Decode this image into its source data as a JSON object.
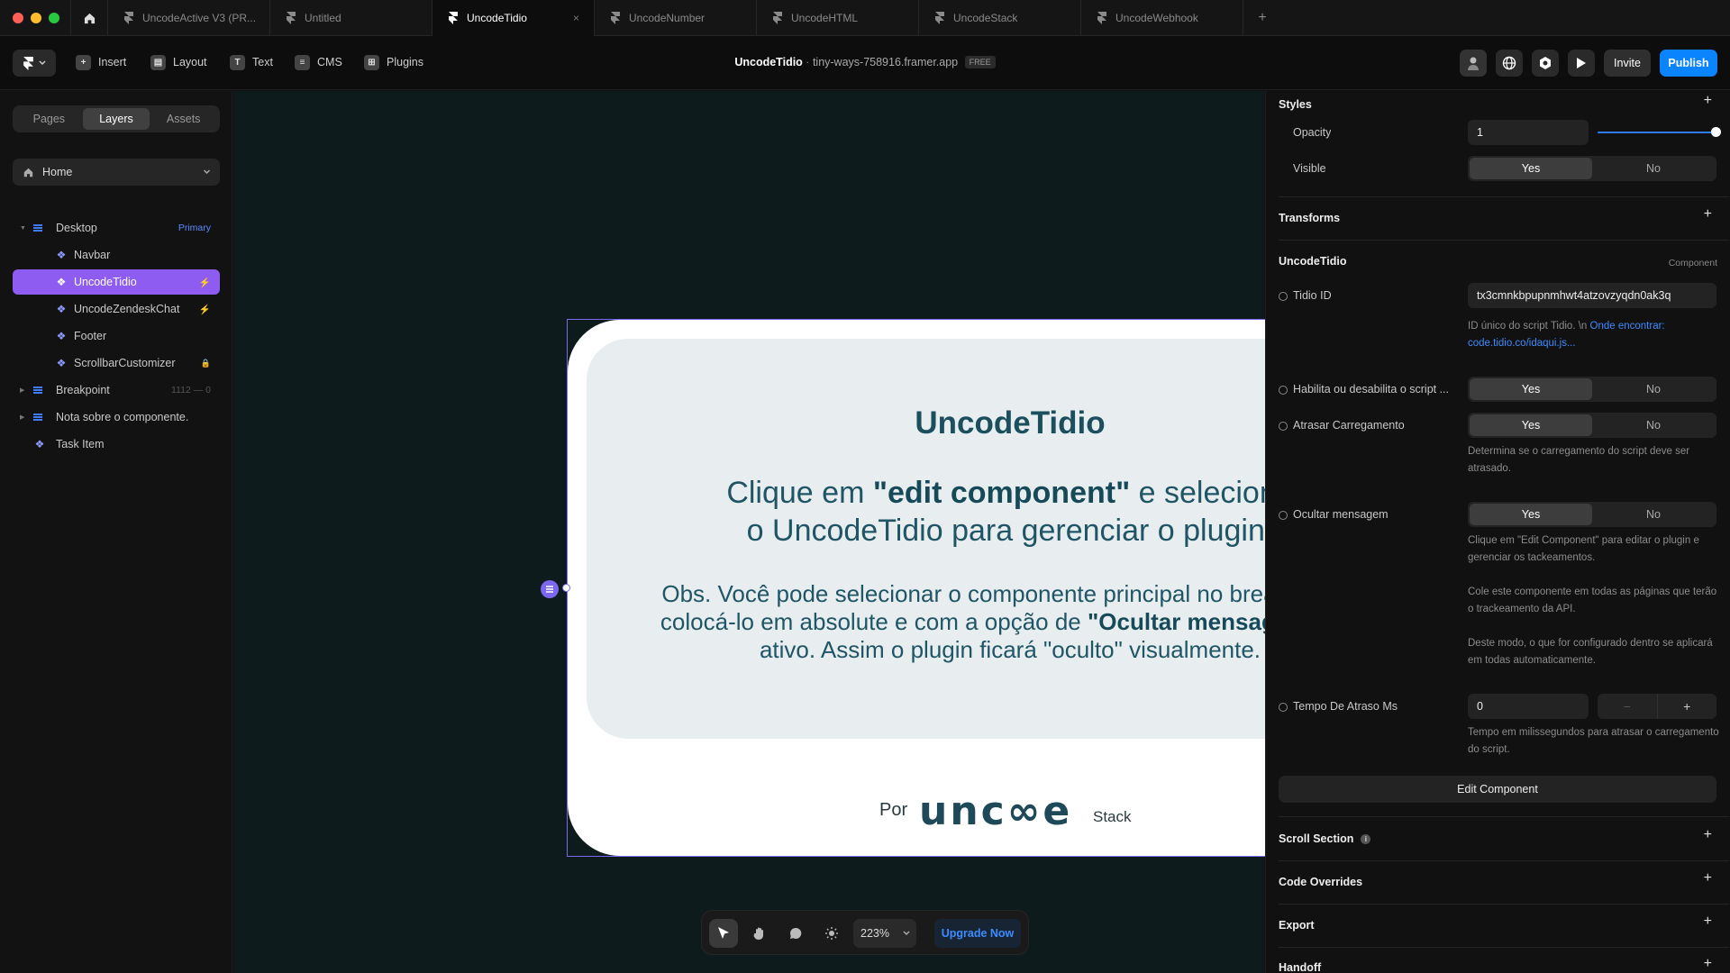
{
  "tabs": [
    {
      "label": "UncodeActive V3 (PR...",
      "active": false
    },
    {
      "label": "Untitled",
      "active": false
    },
    {
      "label": "UncodeTidio",
      "active": true,
      "close": "×"
    },
    {
      "label": "UncodeNumber",
      "active": false
    },
    {
      "label": "UncodeHTML",
      "active": false
    },
    {
      "label": "UncodeStack",
      "active": false
    },
    {
      "label": "UncodeWebhook",
      "active": false
    }
  ],
  "new_tab": "+",
  "toolbar": {
    "items": [
      "Insert",
      "Layout",
      "Text",
      "CMS",
      "Plugins"
    ],
    "project_name": "UncodeTidio",
    "project_domain": "tiny-ways-758916.framer.app",
    "plan_badge": "FREE",
    "invite": "Invite",
    "publish": "Publish"
  },
  "left_panel": {
    "tabs": [
      "Pages",
      "Layers",
      "Assets"
    ],
    "active_tab": "Layers",
    "page_select": "Home",
    "layers": [
      {
        "label": "Desktop",
        "type": "frame",
        "right": "Primary",
        "indent": 0,
        "caret": true
      },
      {
        "label": "Navbar",
        "type": "component",
        "right": "",
        "indent": 1
      },
      {
        "label": "UncodeTidio",
        "type": "component",
        "right": "⚡",
        "indent": 1,
        "selected": true
      },
      {
        "label": "UncodeZendeskChat",
        "type": "component",
        "right": "⚡",
        "indent": 1
      },
      {
        "label": "Footer",
        "type": "component",
        "right": "",
        "indent": 1
      },
      {
        "label": "ScrollbarCustomizer",
        "type": "component",
        "right": "🔒",
        "indent": 1
      },
      {
        "label": "Breakpoint",
        "type": "frame",
        "right": "1112 — 0",
        "indent": 0,
        "caret": true
      },
      {
        "label": "Nota sobre o componente.",
        "type": "frame",
        "right": "",
        "indent": 0,
        "caret": true
      },
      {
        "label": "Task Item",
        "type": "component",
        "right": "",
        "indent": 0
      }
    ]
  },
  "canvas": {
    "title": "UncodeTidio",
    "line1_pre": "Clique em ",
    "line1_bold": "\"edit component\"",
    "line1_post": " e selecione",
    "line2": "o UncodeTidio para gerenciar o plugin.",
    "obs_pre": "Obs. Você pode selecionar o componente principal no breakpoint e colocá-lo em absolute e com a opção de ",
    "obs_bold": "\"Ocultar mensagem\"",
    "obs_post": " em ativo. Assim o plugin ficará \"oculto\" visualmente.",
    "brand_por": "Por",
    "brand_logo": "unc∞e",
    "brand_stack": "Stack",
    "zoom": "223%",
    "upgrade": "Upgrade Now"
  },
  "right_panel": {
    "styles_title": "Styles",
    "opacity_label": "Opacity",
    "opacity_value": "1",
    "visible_label": "Visible",
    "visible_yes": "Yes",
    "visible_no": "No",
    "transforms_title": "Transforms",
    "component_title": "UncodeTidio",
    "component_tag": "Component",
    "tidio_id_label": "Tidio ID",
    "tidio_id_value": "tx3cmnkbpupnmhwt4atzovzyqdn0ak3q",
    "tidio_desc_pre": "ID único do script Tidio. \\n ",
    "tidio_desc_link": "Onde encontrar: code.tidio.co/idaqui.js...",
    "enable_label": "Habilita ou desabilita o script ...",
    "delay_label": "Atrasar Carregamento",
    "delay_desc": "Determina se o carregamento do script deve ser atrasado.",
    "hide_label": "Ocultar mensagem",
    "hide_desc1": "Clique em \"Edit Component\" para editar o plugin e gerenciar os tackeamentos.",
    "hide_desc2": "Cole este componente em todas as páginas que terão o trackeamento da API.",
    "hide_desc3": "Deste modo, o que for configurado dentro se aplicará em todas automaticamente.",
    "delay_ms_label": "Tempo De Atraso Ms",
    "delay_ms_value": "0",
    "delay_ms_desc": "Tempo em milissegundos para atrasar o carregamento do script.",
    "yes": "Yes",
    "no": "No",
    "edit_component": "Edit Component",
    "scroll_section": "Scroll Section",
    "code_overrides": "Code Overrides",
    "export": "Export",
    "handoff": "Handoff"
  },
  "colors": {
    "accent": "#0a84ff",
    "selection": "#8e5cf0",
    "canvas_bg": "#0e1b1c",
    "card_text": "#1f5565"
  }
}
